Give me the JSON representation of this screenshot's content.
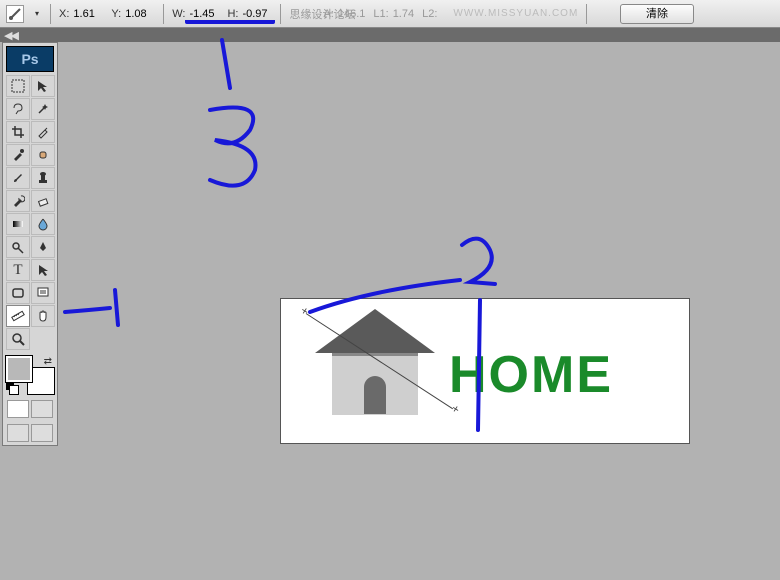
{
  "topbar": {
    "x_label": "X:",
    "x_value": "1.61",
    "y_label": "Y:",
    "y_value": "1.08",
    "w_label": "W:",
    "w_value": "-1.45",
    "h_label": "H:",
    "h_value": "-0.97",
    "a_label": "A:",
    "a_value": "146.1",
    "l1_label": "L1:",
    "l1_value": "1.74",
    "l2_label": "L2:",
    "l2_value": "",
    "faded_text": "思缘设计论坛",
    "watermark": "WWW.MISSYUAN.COM",
    "clear_btn": "清除"
  },
  "canvas": {
    "text": "HOME"
  },
  "annotations": {
    "n1": "1",
    "n2": "2",
    "n3": "3"
  },
  "tools": {
    "logo": "Ps",
    "items": [
      "marquee",
      "move",
      "lasso",
      "wand",
      "crop",
      "slice",
      "eyedrop",
      "heal",
      "brush",
      "stamp",
      "history",
      "eraser",
      "gradient",
      "blur",
      "dodge",
      "pen",
      "type",
      "path",
      "note",
      "ruler",
      "hand",
      "zoom"
    ]
  }
}
